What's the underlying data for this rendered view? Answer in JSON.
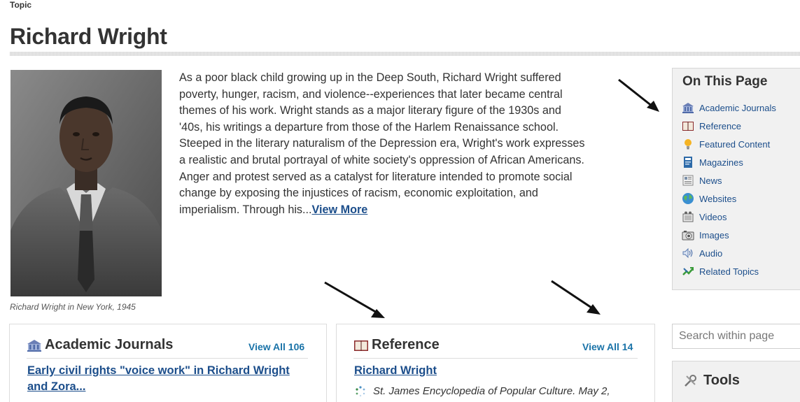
{
  "page": {
    "topic_label": "Topic",
    "title": "Richard Wright"
  },
  "portrait": {
    "caption": "Richard Wright in New York, 1945"
  },
  "summary": {
    "text": "As a poor black child growing up in the Deep South, Richard Wright suffered poverty, hunger, racism, and violence--experiences that later became central themes of his work. Wright stands as a major literary figure of the 1930s and '40s, his writings a departure from those of the Harlem Renaissance school. Steeped in the literary naturalism of the Depression era, Wright's work expresses a realistic and brutal portrayal of white society's oppression of African Americans. Anger and protest served as a catalyst for literature intended to promote social change by exposing the injustices of racism, economic exploitation, and imperialism. Through his...",
    "view_more": "View More"
  },
  "on_this_page": {
    "title": "On This Page",
    "items": [
      {
        "label": "Academic Journals",
        "icon": "academic-journals-icon"
      },
      {
        "label": "Reference",
        "icon": "reference-book-icon"
      },
      {
        "label": "Featured Content",
        "icon": "lightbulb-icon"
      },
      {
        "label": "Magazines",
        "icon": "magazine-icon"
      },
      {
        "label": "News",
        "icon": "newspaper-icon"
      },
      {
        "label": "Websites",
        "icon": "globe-icon"
      },
      {
        "label": "Videos",
        "icon": "video-icon"
      },
      {
        "label": "Images",
        "icon": "camera-icon"
      },
      {
        "label": "Audio",
        "icon": "speaker-icon"
      },
      {
        "label": "Related Topics",
        "icon": "related-topics-icon"
      }
    ]
  },
  "academic_journals": {
    "title": "Academic Journals",
    "view_all": "View All 106",
    "first_link": "Early civil rights \"voice work\" in Richard Wright and Zora..."
  },
  "reference": {
    "title": "Reference",
    "view_all": "View All 14",
    "first_link": "Richard Wright",
    "first_source": "St. James Encyclopedia of Popular Culture. May 2,"
  },
  "search": {
    "placeholder": "Search within page"
  },
  "tools": {
    "title": "Tools"
  },
  "colors": {
    "link": "#1c4e8b",
    "view_all": "#1a73a8",
    "panel_bg": "#f1f1f1"
  }
}
